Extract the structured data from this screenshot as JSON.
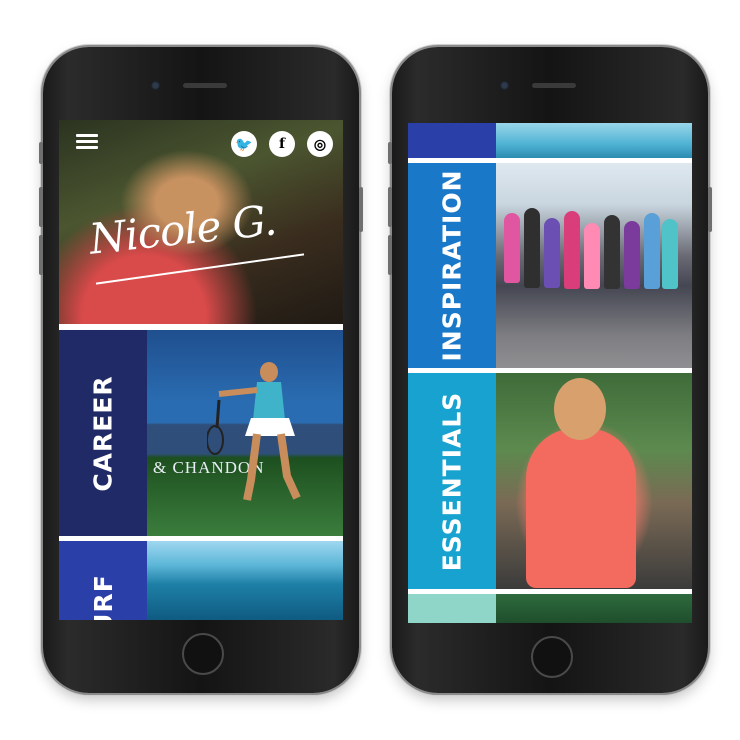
{
  "colors": {
    "career": "#1f2a66",
    "surf": "#2a3fa8",
    "inspiration": "#1a78c9",
    "essentials": "#18a2cf",
    "bottom_tab": "#8fd6c8",
    "top_tab": "#2a3fa8"
  },
  "left_phone": {
    "header": {
      "menu_icon": "hamburger-icon",
      "social_icons": [
        "twitter-icon",
        "facebook-icon",
        "instagram-icon"
      ],
      "twitter_glyph": "🐦",
      "facebook_glyph": "f",
      "instagram_glyph": "◎"
    },
    "hero": {
      "signature": "Nicole G."
    },
    "panels": [
      {
        "label": "CAREER",
        "ad_text": "& CHANDON"
      },
      {
        "label": "SURF"
      }
    ]
  },
  "right_phone": {
    "panels": [
      {
        "label": "INSPIRATION"
      },
      {
        "label": "ESSENTIALS"
      }
    ]
  }
}
